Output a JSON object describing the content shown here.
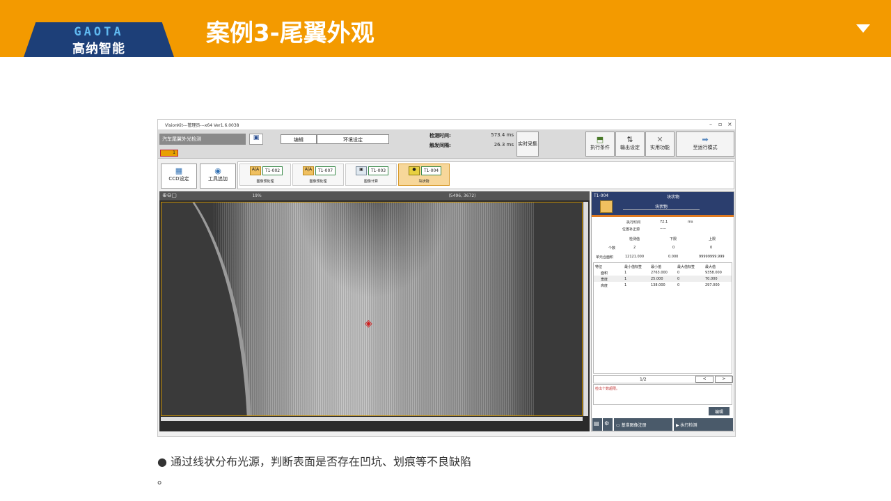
{
  "header": {
    "logo_en": "GAOTA",
    "logo_cn": "高纳智能",
    "title": "案例3-尾翼外观",
    "colors": {
      "bar": "#F39A00",
      "logo_bg": "#1d3f78"
    }
  },
  "app": {
    "window_title": "VisionKit---管理员---x64 Ver1.6.0038",
    "window_controls": [
      "–",
      "▫",
      "×"
    ],
    "program_select": "汽车尾翼外光检测",
    "tag": "1",
    "menu_edit": "编辑",
    "menu_env": "环境设定",
    "detect_time_label": "检测时间:",
    "detect_time_value": "573.4 ms",
    "trigger_interval_label": "触发间隔:",
    "trigger_interval_value": "26.3 ms",
    "realtime_btn": "实时采集",
    "toolbar": {
      "exec_condition": "执行条件",
      "output_setting": "输出设定",
      "utility": "实用功能",
      "run_mode": "至运行模式"
    },
    "ccd_setting": "CCD设定",
    "tool_add": "工具追加",
    "tools": [
      {
        "id": "T1-002",
        "name": "图像预处理",
        "icon": "A|A",
        "selected": false
      },
      {
        "id": "T1-007",
        "name": "图像预处理",
        "icon": "A|A",
        "selected": false
      },
      {
        "id": "T1-003",
        "name": "图像计算",
        "icon": "img",
        "selected": false
      },
      {
        "id": "T1-004",
        "name": "块状物",
        "icon": "blob",
        "selected": true
      }
    ],
    "viewer": {
      "zoom": "19%",
      "coords": "(5496, 3672)"
    },
    "panel": {
      "tool_id": "T1-004",
      "tool_title": "块状物",
      "tool_subtitle": "块状物",
      "exec_time_label": "执行时间",
      "exec_time_value": "72.1",
      "exec_time_unit": "ms",
      "pos_correction_label": "位置补正源",
      "pos_correction_value": "-----",
      "col_detect": "检测值",
      "col_lower": "下限",
      "col_upper": "上限",
      "count_label": "个数",
      "count_value": "2",
      "count_lower": "0",
      "count_upper": "0",
      "total_area_label": "单元合面积",
      "total_area_value": "12121.000",
      "total_area_lower": "0.000",
      "total_area_upper": "99999999.999",
      "feature_headers": [
        "特征",
        "最小值标签",
        "最小值",
        "最大值标签",
        "最大值"
      ],
      "features": [
        {
          "name": "面积",
          "min_label": "1",
          "min": "2763.000",
          "max_label": "0",
          "max": "9358.000"
        },
        {
          "name": "宽度",
          "min_label": "1",
          "min": "25.000",
          "max_label": "0",
          "max": "70.000"
        },
        {
          "name": "高度",
          "min_label": "1",
          "min": "138.000",
          "max_label": "0",
          "max": "297.000"
        }
      ],
      "page": "1/2",
      "prev": "<",
      "next": ">",
      "message": "检出个数超限。",
      "edit_btn": "编辑",
      "register_btn": "基准图像注册",
      "run_btn": "执行检测"
    }
  },
  "caption": "● 通过线状分布光源，判断表面是否存在凹坑、划痕等不良缺陷",
  "caption_tail": "。"
}
